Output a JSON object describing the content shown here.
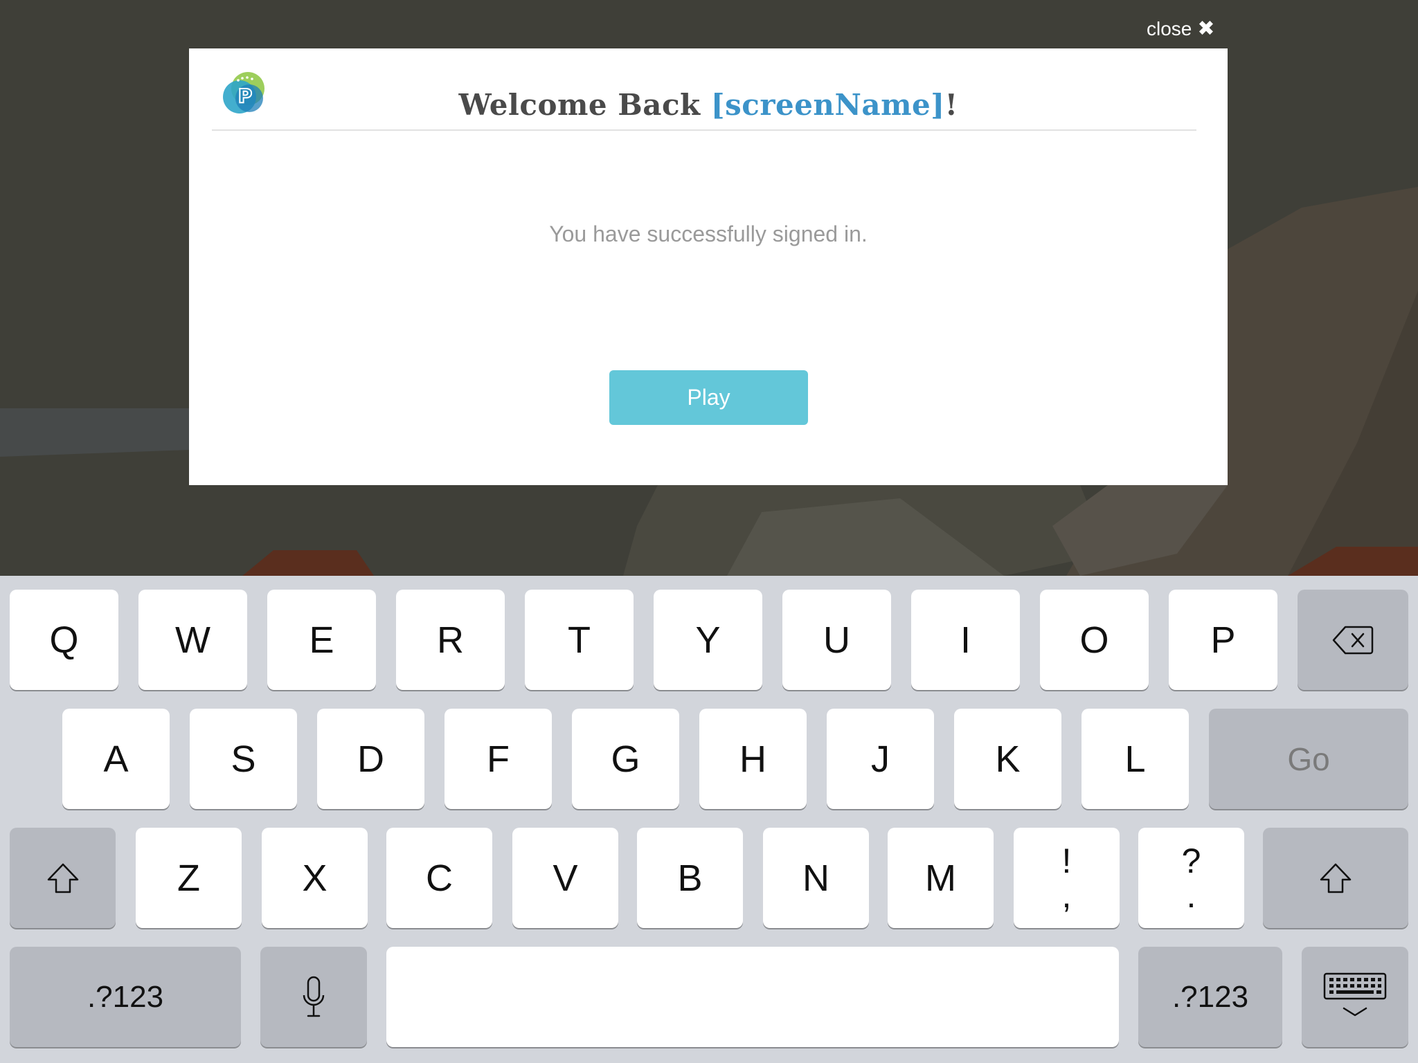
{
  "close": {
    "label": "close",
    "icon": "close-x-icon"
  },
  "modal": {
    "logo_icon": "p-logo-icon",
    "title_prefix": "Welcome Back ",
    "title_name": "[screenName]",
    "title_suffix": "!",
    "message": "You have successfully signed in.",
    "play_label": "Play",
    "colors": {
      "accent": "#3c93c9",
      "button": "#63c7d9"
    }
  },
  "keyboard": {
    "row1": [
      "Q",
      "W",
      "E",
      "R",
      "T",
      "Y",
      "U",
      "I",
      "O",
      "P"
    ],
    "row2": [
      "A",
      "S",
      "D",
      "F",
      "G",
      "H",
      "J",
      "K",
      "L"
    ],
    "row3": [
      "Z",
      "X",
      "C",
      "V",
      "B",
      "N",
      "M"
    ],
    "punct1": {
      "top": "!",
      "bottom": ","
    },
    "punct2": {
      "top": "?",
      "bottom": "."
    },
    "go_label": "Go",
    "numbers_label": ".?123",
    "icons": {
      "delete": "backspace-icon",
      "shift": "shift-arrow-icon",
      "mic": "microphone-icon",
      "dismiss": "keyboard-dismiss-icon"
    }
  }
}
